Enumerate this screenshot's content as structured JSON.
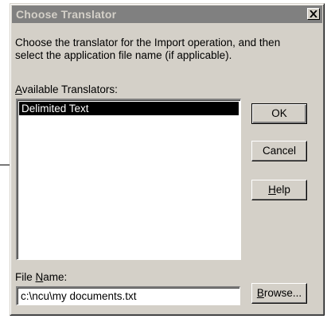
{
  "dialog": {
    "title": "Choose Translator",
    "close_glyph": "✕",
    "instructions": "Choose the translator for the Import operation, and then select the application file name (if applicable).",
    "translators_label": {
      "mnemonic": "A",
      "rest": "vailable Translators:"
    },
    "translators": [
      {
        "label": "Delimited Text",
        "selected": true
      }
    ],
    "buttons": {
      "ok": "OK",
      "cancel": "Cancel",
      "help": {
        "mnemonic": "H",
        "rest": "elp"
      },
      "browse": {
        "mnemonic": "B",
        "rest": "rowse..."
      }
    },
    "file_name_label": {
      "before": "File ",
      "mnemonic": "N",
      "rest": "ame:"
    },
    "file_name_value": "c:\\ncu\\my documents.txt"
  },
  "colors": {
    "dialog_face": "#d4d0c8",
    "titlebar_inactive": "#808080",
    "selection": "#000000"
  }
}
